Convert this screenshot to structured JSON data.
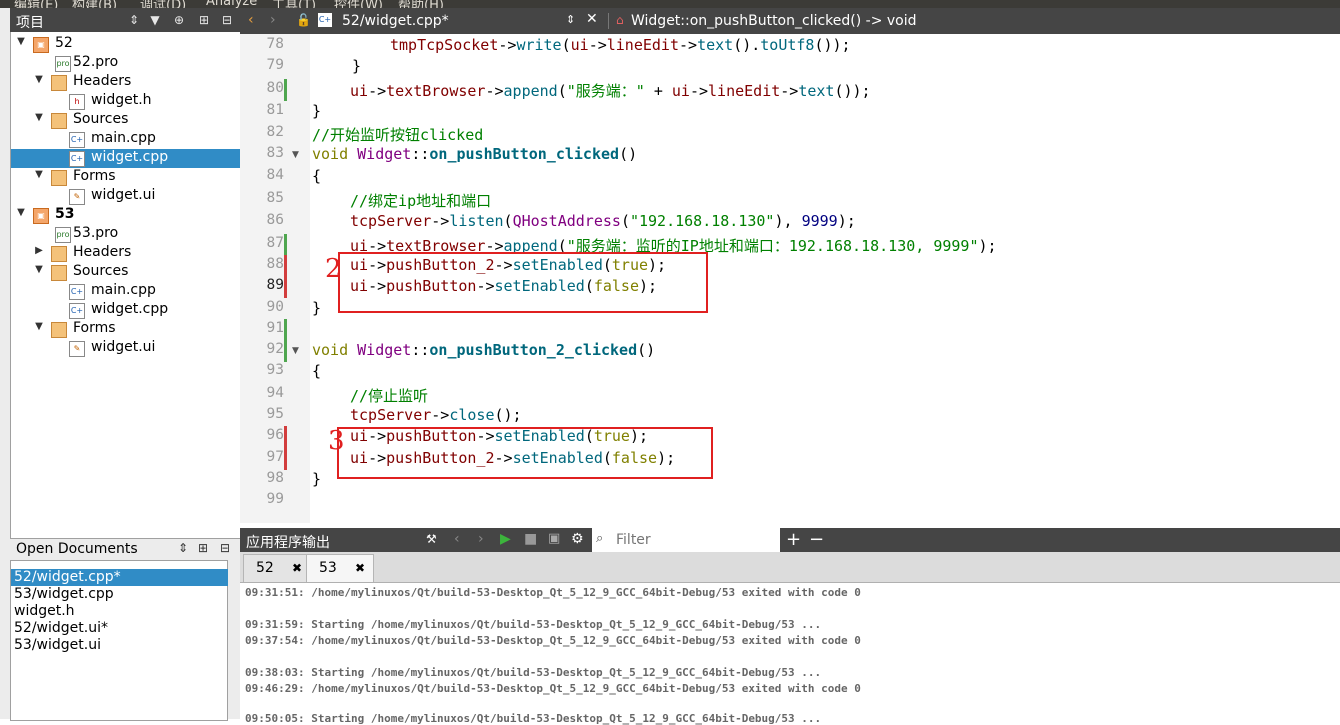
{
  "menubar": {
    "items": [
      "编辑(E)",
      "构建(B)",
      "调试(D)",
      "Analyze",
      "工具(T)",
      "控件(W)",
      "帮助(H)"
    ]
  },
  "project_panel": {
    "title": "项目",
    "tree": [
      {
        "label": "52",
        "type": "project",
        "expanded": true
      },
      {
        "label": "52.pro",
        "type": "pro"
      },
      {
        "label": "Headers",
        "type": "folder",
        "expanded": true
      },
      {
        "label": "widget.h",
        "type": "header"
      },
      {
        "label": "Sources",
        "type": "folder",
        "expanded": true
      },
      {
        "label": "main.cpp",
        "type": "cpp"
      },
      {
        "label": "widget.cpp",
        "type": "cpp",
        "selected": true
      },
      {
        "label": "Forms",
        "type": "folder",
        "expanded": true
      },
      {
        "label": "widget.ui",
        "type": "ui"
      },
      {
        "label": "53",
        "type": "project",
        "expanded": true
      },
      {
        "label": "53.pro",
        "type": "pro"
      },
      {
        "label": "Headers",
        "type": "folder",
        "expanded": false
      },
      {
        "label": "Sources",
        "type": "folder",
        "expanded": true
      },
      {
        "label": "main.cpp",
        "type": "cpp"
      },
      {
        "label": "widget.cpp",
        "type": "cpp"
      },
      {
        "label": "Forms",
        "type": "folder",
        "expanded": true
      },
      {
        "label": "widget.ui",
        "type": "ui"
      }
    ]
  },
  "open_documents": {
    "title": "Open Documents",
    "items": [
      "52/widget.cpp*",
      "53/widget.cpp",
      "widget.h",
      "52/widget.ui*",
      "53/widget.ui"
    ],
    "selected_index": 0
  },
  "editor_toolbar": {
    "file_name": "52/widget.cpp*",
    "function_name": "Widget::on_pushButton_clicked() -> void"
  },
  "editor": {
    "current_line": 89,
    "line_numbers": [
      78,
      79,
      80,
      81,
      82,
      83,
      84,
      85,
      86,
      87,
      88,
      89,
      90,
      91,
      92,
      93,
      94,
      95,
      96,
      97,
      98,
      99
    ],
    "annotations": [
      "2",
      "3"
    ]
  },
  "code_text": {
    "l78": [
      "tmpTcpSocket",
      "->",
      "write",
      "(",
      "ui",
      "->",
      "lineEdit",
      "->",
      "text",
      "().",
      "toUtf8",
      "());"
    ],
    "l79": "}",
    "l80": [
      "ui",
      "->",
      "textBrowser",
      "->",
      "append",
      "(",
      "\"服务端：\"",
      " + ",
      "ui",
      "->",
      "lineEdit",
      "->",
      "text",
      "());"
    ],
    "l81": "}",
    "l82": "//开始监听按钮clicked",
    "l83": [
      "void",
      " ",
      "Widget",
      "::",
      "on_pushButton_clicked",
      "()"
    ],
    "l84": "{",
    "l85": "//绑定ip地址和端口",
    "l86": [
      "tcpServer",
      "->",
      "listen",
      "(",
      "QHostAddress",
      "(",
      "\"192.168.18.130\"",
      "), ",
      "9999",
      ");"
    ],
    "l87": [
      "ui",
      "->",
      "textBrowser",
      "->",
      "append",
      "(",
      "\"服务端：监听的IP地址和端口：192.168.18.130, 9999\"",
      ");"
    ],
    "l88": [
      "ui",
      "->",
      "pushButton_2",
      "->",
      "setEnabled",
      "(",
      "true",
      ");"
    ],
    "l89": [
      "ui",
      "->",
      "pushButton",
      "->",
      "setEnabled",
      "(",
      "false",
      ");"
    ],
    "l90": "}",
    "l92": [
      "void",
      " ",
      "Widget",
      "::",
      "on_pushButton_2_clicked",
      "()"
    ],
    "l93": "{",
    "l94": "//停止监听",
    "l95": [
      "tcpServer",
      "->",
      "close",
      "();"
    ],
    "l96": [
      "ui",
      "->",
      "pushButton",
      "->",
      "setEnabled",
      "(",
      "true",
      ");"
    ],
    "l97": [
      "ui",
      "->",
      "pushButton_2",
      "->",
      "setEnabled",
      "(",
      "false",
      ");"
    ],
    "l98": "}"
  },
  "output_pane": {
    "title": "应用程序输出",
    "filter_placeholder": "Filter",
    "tabs": [
      {
        "label": "52"
      },
      {
        "label": "53",
        "active": true
      }
    ],
    "lines": [
      "09:31:51: /home/mylinuxos/Qt/build-53-Desktop_Qt_5_12_9_GCC_64bit-Debug/53 exited with code 0",
      "",
      "09:31:59: Starting /home/mylinuxos/Qt/build-53-Desktop_Qt_5_12_9_GCC_64bit-Debug/53 ...",
      "09:37:54: /home/mylinuxos/Qt/build-53-Desktop_Qt_5_12_9_GCC_64bit-Debug/53 exited with code 0",
      "",
      "09:38:03: Starting /home/mylinuxos/Qt/build-53-Desktop_Qt_5_12_9_GCC_64bit-Debug/53 ...",
      "09:46:29: /home/mylinuxos/Qt/build-53-Desktop_Qt_5_12_9_GCC_64bit-Debug/53 exited with code 0",
      "",
      "09:50:05: Starting /home/mylinuxos/Qt/build-53-Desktop_Qt_5_12_9_GCC_64bit-Debug/53 ..."
    ]
  },
  "icons": [
    "sort-icon",
    "filter-icon",
    "link-icon",
    "split-icon",
    "close-icon",
    "back-icon",
    "forward-icon",
    "lock-icon",
    "cpp-file-icon",
    "function-icon",
    "build-icon",
    "run-icon",
    "stop-icon",
    "settings-icon",
    "search-icon",
    "plus-icon",
    "minus-icon"
  ],
  "colors": {
    "panel_dark": "#454545",
    "selection": "#308cc6",
    "annotation_red": "#e02020",
    "change_green": "#4fa64f"
  }
}
